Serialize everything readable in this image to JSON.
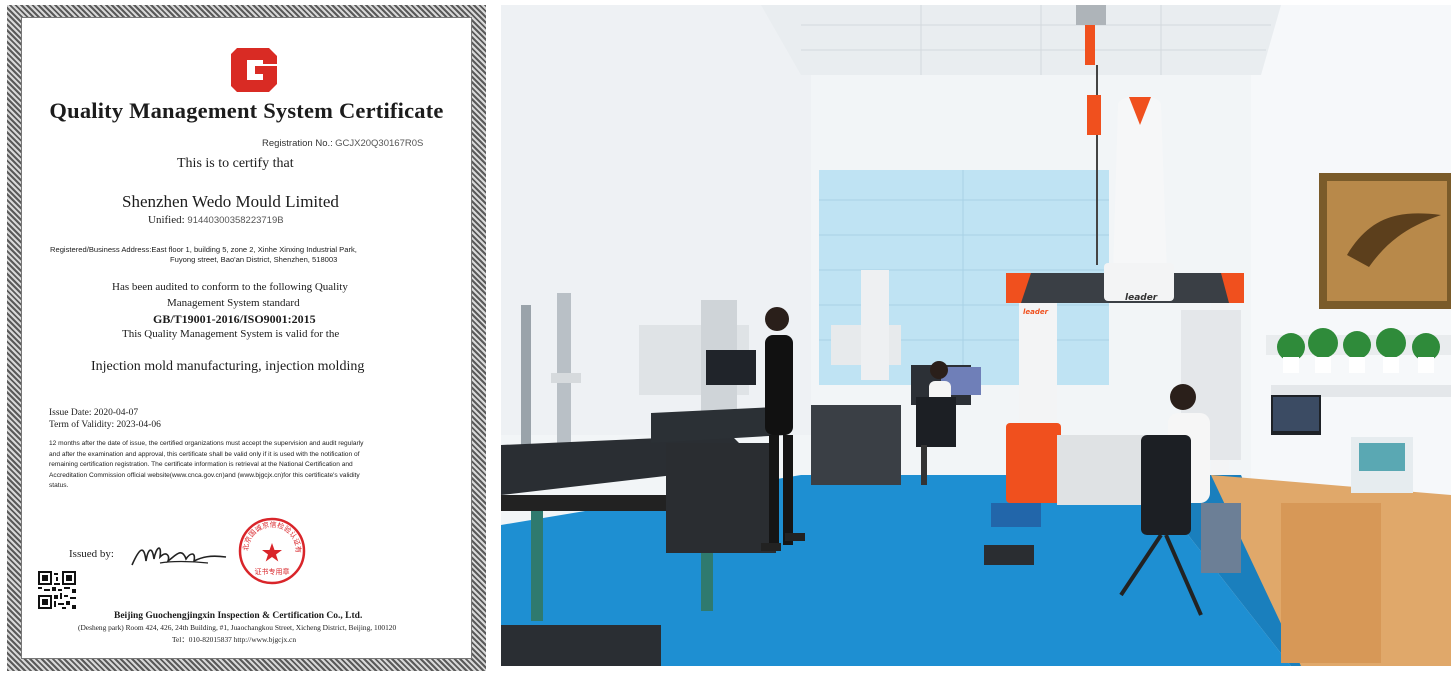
{
  "certificate": {
    "title": "Quality Management System Certificate",
    "registration_label": "Registration No.:",
    "registration_value": "GCJX20Q30167R0S",
    "certify_line": "This is to certify that",
    "company": "Shenzhen Wedo Mould Limited",
    "unified_label": "Unified:",
    "unified_value": "91440300358223719B",
    "address_label": "Registered/Business Address:",
    "address_line1": "East floor 1, building 5, zone 2, Xinhe Xinxing Industrial Park,",
    "address_line2": "Fuyong street, Bao'an District, Shenzhen, 518003",
    "audit_line1": "Has been audited to conform to the following Quality",
    "audit_line2": "Management System standard",
    "standard": "GB/T19001-2016/ISO9001:2015",
    "valid_for": "This Quality Management System is valid for the",
    "scope": "Injection mold manufacturing, injection molding",
    "issue_date": "Issue Date: 2020-04-07",
    "term": "Term of Validity: 2023-04-06",
    "notice": [
      "12 months after the date of issue, the certified organizations must accept the supervision and audit regularly",
      "and after the examination and approval, this certificate shall be valid only if it is used with the notification of",
      "remaining certification registration. The certificate information is retrieval at the National Certification and",
      "Accreditation Commission official website(www.cnca.gov.cn)and (www.bjgcjx.cn)for this certificate's validity",
      "status."
    ],
    "issued_by": "Issued by:",
    "seal_text": "北京国诚京信检验认证有限公司",
    "seal_sub": "证书专用章",
    "issuer": "Beijing Guochengjingxin Inspection & Certification Co., Ltd.",
    "issuer_address": "(Desheng park) Room 424, 426, 24th Building, #1, Juaochangkou Street, Xicheng District, Beijing, 100120",
    "issuer_contact": "Tel：010-82015837    http://www.bjgcjx.cn",
    "colors": {
      "logo_red": "#d92b24",
      "seal_red": "#d9252a"
    }
  },
  "photo": {
    "machine_brand": "leader",
    "colors": {
      "floor_blue": "#1e8fd2",
      "machine_orange": "#f0501e",
      "wall": "#f2f5f7"
    }
  }
}
